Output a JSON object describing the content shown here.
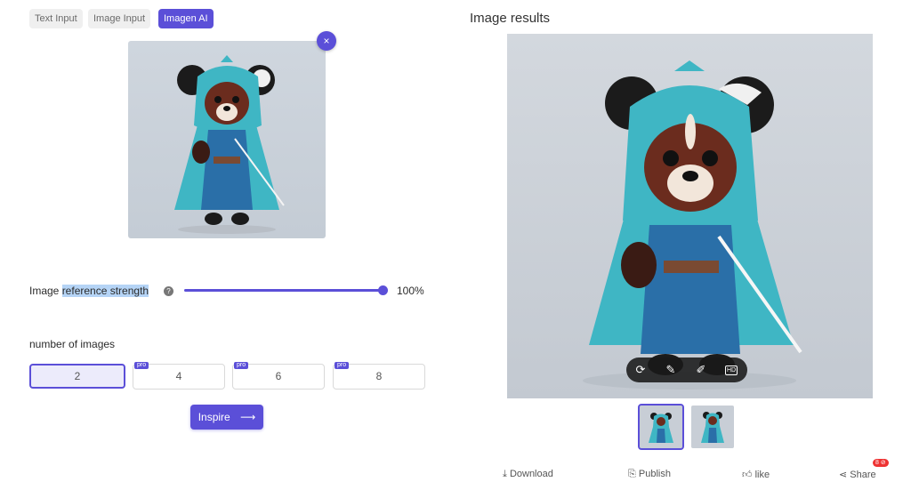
{
  "tabs": [
    {
      "label": "Text Input",
      "active": false
    },
    {
      "label": "Image Input",
      "active": false
    },
    {
      "label": "Imagen AI",
      "active": true
    }
  ],
  "close_icon": "×",
  "strength": {
    "label_prefix": "Image ",
    "label_highlight": "reference strength",
    "help_icon": "?",
    "value_text": "100%",
    "value": 1.0
  },
  "num_images": {
    "label": "number of images",
    "options": [
      "2",
      "4",
      "6",
      "8"
    ],
    "selected": "2",
    "pro_badge": "pro"
  },
  "inspire": {
    "label": "Inspire",
    "arrow": "⟶"
  },
  "results": {
    "title": "Image results",
    "actions": {
      "download": "Download",
      "publish": "Publish",
      "like": "like",
      "share": "Share",
      "badge": "8 ⊘"
    }
  },
  "colors": {
    "accent": "#5b4fd8",
    "robe": "#3fb6c4",
    "badge": "#e33333"
  }
}
